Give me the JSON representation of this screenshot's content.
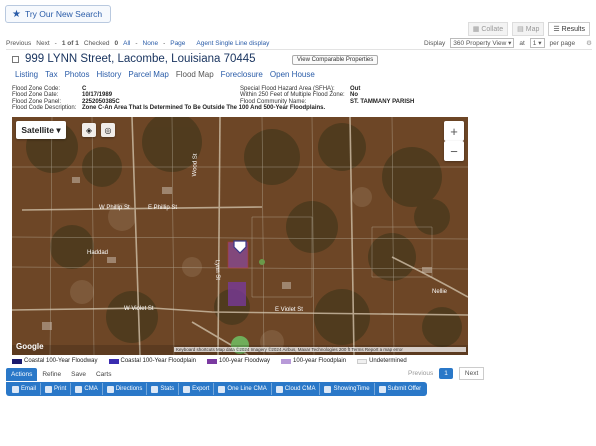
{
  "topbar": {
    "try_label": "Try Our New Search",
    "view_tabs": [
      {
        "label": "Collate",
        "active": false
      },
      {
        "label": "Map",
        "active": false
      },
      {
        "label": "Results",
        "active": true
      }
    ]
  },
  "navbar": {
    "previous": "Previous",
    "next": "Next",
    "count": "1 of 1",
    "checked_label": "Checked",
    "checked_count": "0",
    "all": "All",
    "none": "None",
    "page": "Page",
    "agent_view": "Agent Single Line display",
    "display_label": "Display",
    "display_value": "360 Property View",
    "at_label": "at",
    "at_value": "1",
    "per_page": "per page"
  },
  "listing": {
    "title": "999 LYNN Street, Lacombe, Louisiana 70445",
    "compare_button": "View Comparable Properties",
    "tabs": [
      {
        "label": "Listing",
        "active": false
      },
      {
        "label": "Tax",
        "active": false
      },
      {
        "label": "Photos",
        "active": false
      },
      {
        "label": "History",
        "active": false
      },
      {
        "label": "Parcel Map",
        "active": false
      },
      {
        "label": "Flood Map",
        "active": true
      },
      {
        "label": "Foreclosure",
        "active": false
      },
      {
        "label": "Open House",
        "active": false
      }
    ]
  },
  "flood": {
    "left": [
      {
        "key": "Flood Zone Code:",
        "value": "C"
      },
      {
        "key": "Flood Zone Date:",
        "value": "10/17/1989"
      },
      {
        "key": "Flood Zone Panel:",
        "value": "2252050385C"
      },
      {
        "key": "Flood Code Description:",
        "value": "Zone C-An Area That Is Determined To Be Outside The 100 And 500-Year Floodplains."
      }
    ],
    "right": [
      {
        "key": "Special Flood Hazard Area (SFHA):",
        "value": "Out"
      },
      {
        "key": "Within 250 Feet of Multiple Flood Zone:",
        "value": "No"
      },
      {
        "key": "Flood Community Name:",
        "value": "ST. TAMMANY PARISH"
      }
    ]
  },
  "map": {
    "type_button": "Satellite",
    "zoom_in": "+",
    "zoom_out": "−",
    "google": "Google",
    "attribution": "Keyboard shortcuts   Map data ©2024 Imagery ©2024 Airbus, Maxar Technologies   200 ft   Terms   Report a map error",
    "streets": [
      "W Phillip St",
      "E Phillip St",
      "Haddad",
      "W Violet St",
      "E Violet St",
      "Wood St",
      "Lynn St",
      "Nellie"
    ]
  },
  "legend": [
    {
      "label": "Coastal 100-Year Floodway",
      "color": "#1a1a6e"
    },
    {
      "label": "Coastal 100-Year Floodplain",
      "color": "#3a2cb0"
    },
    {
      "label": "100-year Floodway",
      "color": "#7a3aa0"
    },
    {
      "label": "100-year Floodplain",
      "color": "#b89ad8"
    },
    {
      "label": "Undetermined",
      "color": "#f0f0f0"
    }
  ],
  "pager": {
    "previous": "Previous",
    "page": "1",
    "next": "Next"
  },
  "action_tabs": [
    {
      "label": "Actions",
      "active": true
    },
    {
      "label": "Refine",
      "active": false
    },
    {
      "label": "Save",
      "active": false
    },
    {
      "label": "Carts",
      "active": false
    }
  ],
  "actions": [
    {
      "label": "Email",
      "icon": "email-icon"
    },
    {
      "label": "Print",
      "icon": "print-icon"
    },
    {
      "label": "CMA",
      "icon": "cma-icon"
    },
    {
      "label": "Directions",
      "icon": "directions-icon"
    },
    {
      "label": "Stats",
      "icon": "stats-icon"
    },
    {
      "label": "Export",
      "icon": "export-icon"
    },
    {
      "label": "One Line CMA",
      "icon": "cma-icon"
    },
    {
      "label": "Cloud CMA",
      "icon": "cloud-icon"
    },
    {
      "label": "ShowingTime",
      "icon": "clock-icon"
    },
    {
      "label": "Submit Offer",
      "icon": "offer-icon"
    }
  ]
}
